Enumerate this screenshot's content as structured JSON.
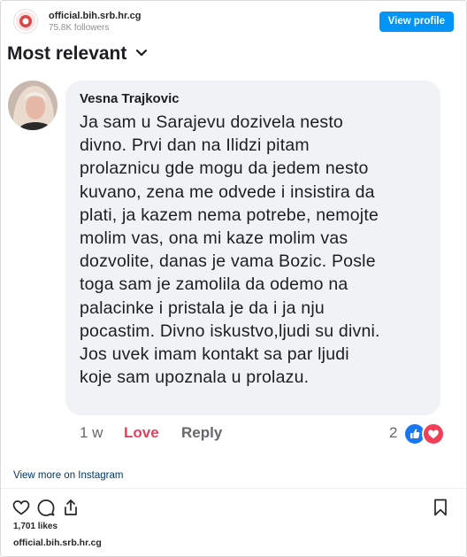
{
  "header": {
    "account_name": "official.bih.srb.hr.cg",
    "followers": "75.8K followers",
    "view_profile_label": "View profile"
  },
  "post": {
    "sort_label": "Most relevant",
    "comment": {
      "author": "Vesna Trajkovic",
      "lines": [
        "Ja sam u Sarajevu dozivela nesto",
        "divno. Prvi dan na Ilidzi pitam",
        "prolaznicu gde mogu da jedem nesto",
        "kuvano, zena me odvede i insistira da",
        "plati, ja kazem nema potrebe, nemojte",
        "molim vas, ona mi kaze molim vas",
        "dozvolite, danas je vama Bozic. Posle",
        "toga sam je zamolila da odemo na",
        "palacinke i pristala je da i ja nju",
        "pocastim. Divno iskustvo,ljudi su divni.",
        "Jos uvek imam kontakt sa par ljudi",
        "koje sam upoznala u prolazu."
      ],
      "time": "1 w",
      "love_label": "Love",
      "reply_label": "Reply",
      "reaction_count": "2"
    }
  },
  "footer": {
    "view_more_label": "View more on Instagram",
    "likes": "1,701 likes",
    "username": "official.bih.srb.hr.cg"
  },
  "colors": {
    "accent": "#0095f6",
    "love": "#e4405f",
    "bubble": "#f0f2f5",
    "like_reaction": "#1877f2",
    "love_reaction": "#f33e58"
  }
}
